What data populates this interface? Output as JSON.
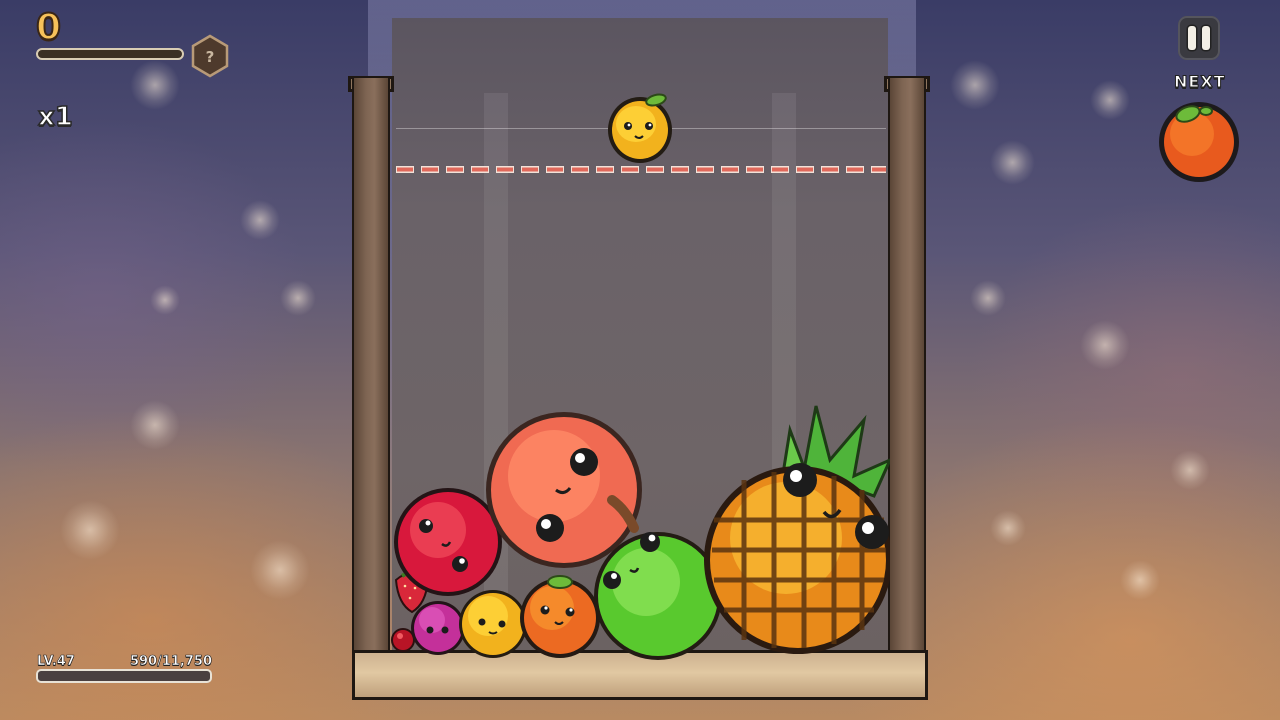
{
  "hud": {
    "score": "0",
    "score_badge": "?",
    "multiplier": "x1",
    "next_label": "NEXT",
    "level": "LV.47",
    "xp": "590/11,750"
  },
  "game": {
    "current_fruit": "lemon",
    "next_fruit": "orange",
    "fruits_in_box": [
      "cherry",
      "strawberry",
      "grape",
      "lemon",
      "orange",
      "apple",
      "peach",
      "pear",
      "pineapple"
    ]
  },
  "colors": {
    "score": "#f6c15a",
    "danger_line": "#e0685a"
  }
}
